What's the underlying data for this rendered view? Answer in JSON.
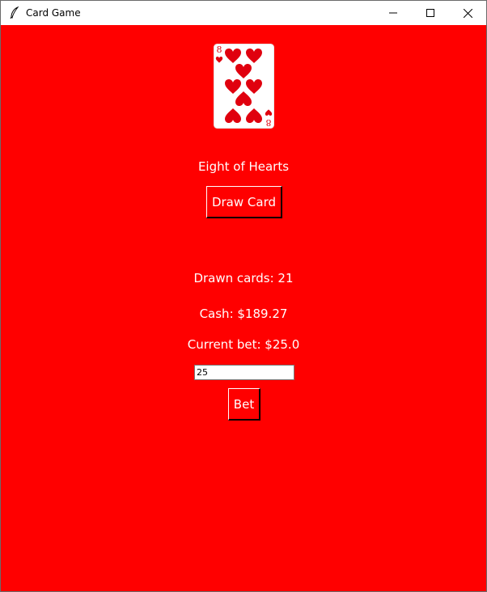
{
  "window": {
    "title": "Card Game"
  },
  "card": {
    "rank": "8",
    "suit_icon": "heart-icon",
    "color": "#e0000e",
    "name": "Eight of Hearts"
  },
  "buttons": {
    "draw_label": "Draw Card",
    "bet_label": "Bet"
  },
  "stats": {
    "drawn_cards": "Drawn cards: 21",
    "cash": "Cash: $189.27",
    "current_bet": "Current bet: $25.0"
  },
  "bet_input": {
    "value": "25"
  },
  "colors": {
    "background": "#ff0000",
    "text": "#ffffff"
  }
}
